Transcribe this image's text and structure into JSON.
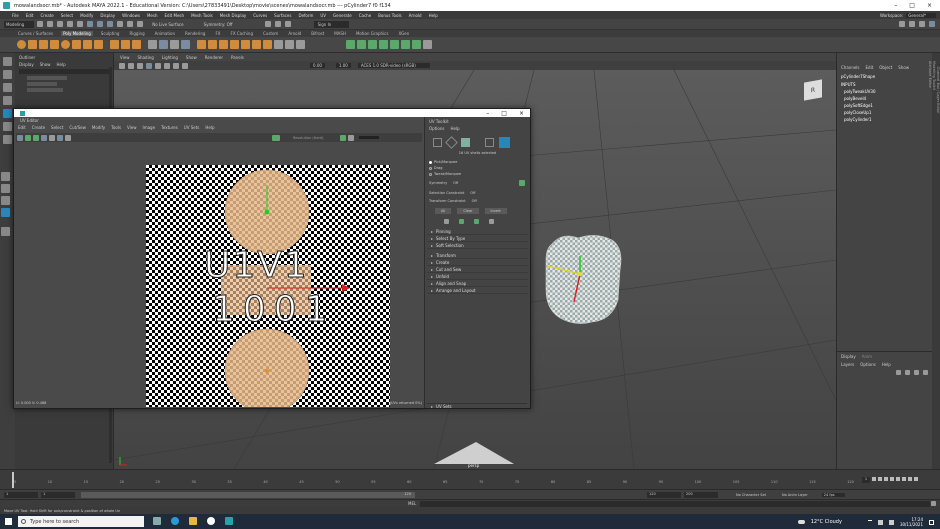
{
  "window": {
    "title": "mowalandsocr.mb* - Autodesk MAYA 2022.1 - Educational Version: C:\\Users\\27833491\\Desktop\\movie\\scenes\\mowalandsocr.mb --- pCylinder7 f0 f134"
  },
  "menubar": [
    "File",
    "Edit",
    "Create",
    "Select",
    "Modify",
    "Display",
    "Windows",
    "Mesh",
    "Edit Mesh",
    "Mesh Tools",
    "Mesh Display",
    "Curves",
    "Surfaces",
    "Deform",
    "UV",
    "Generate",
    "Cache",
    "Bonus Tools",
    "Arnold",
    "Help"
  ],
  "status": {
    "mode": "Modeling",
    "live_surface": "No Live Surface",
    "symmetry": "Symmetry: Off",
    "sign_in": "Sign In",
    "workspace_label": "Workspace:",
    "workspace_value": "General*"
  },
  "shelf_tabs": [
    "Curves / Surfaces",
    "Poly Modeling",
    "Sculpting",
    "Rigging",
    "Animation",
    "Rendering",
    "FX",
    "FX Caching",
    "Custom",
    "Arnold",
    "Bifrost",
    "MASH",
    "Motion Graphics",
    "XGen"
  ],
  "shelf_active": "Poly Modeling",
  "outliner": {
    "title": "Outliner",
    "menu": [
      "Display",
      "Show",
      "Help"
    ],
    "search_placeholder": "Search..."
  },
  "viewport": {
    "menu": [
      "View",
      "Shading",
      "Lighting",
      "Show",
      "Renderer",
      "Panels"
    ],
    "exposure": "0.00",
    "gamma": "1.00",
    "color_space": "ACES 1.0 SDR-video (sRGB)",
    "camera_label": "persp",
    "cube_label": "R"
  },
  "uv_editor": {
    "title": "UV Editor",
    "menu": [
      "Edit",
      "Create",
      "Select",
      "Cut/Sew",
      "Modify",
      "Tools",
      "View",
      "Image",
      "Textures",
      "UV Sets",
      "Help"
    ],
    "resolution_label": "Resolution (Hard)",
    "coords": "U: 0.000 V: 0.488",
    "status_right": "(UVs returned 0%)",
    "tile_text_top": "U1V1",
    "tile_text_bottom": "1001"
  },
  "uv_toolkit": {
    "title": "UV Toolkit",
    "menu": [
      "Options",
      "Help"
    ],
    "selected_info": "16 UV shells selected",
    "pick_marquee": "Pick/Marquee",
    "drag": "Drag",
    "tweak_marquee": "Tweak/Marquee",
    "symmetry_label": "Symmetry",
    "symmetry_value": "Off",
    "selection_constraint_label": "Selection Constraint",
    "selection_constraint_value": "Off",
    "transform_constraint_label": "Transform Constraint",
    "transform_constraint_value": "Off",
    "buttons": [
      "All",
      "Clear",
      "Invert"
    ],
    "sections": [
      "Pinning",
      "Select By Type",
      "Soft Selection",
      "Transform",
      "Create",
      "Cut and Sew",
      "Unfold",
      "Align and Snap",
      "Arrange and Layout"
    ],
    "uv_sets_section": "UV Sets"
  },
  "channel_box": {
    "tabs": [
      "Channels",
      "Edit",
      "Object",
      "Show"
    ],
    "object": "pCylinder7Shape",
    "inputs_label": "INPUTS",
    "inputs": [
      "polyTweakUV30",
      "polyBevel4",
      "polySoftEdge1",
      "polyCloseUp1",
      "polyCylinder1"
    ],
    "display_tabs": [
      "Display",
      "Anim"
    ],
    "layer_menu": [
      "Layers",
      "Options",
      "Help"
    ],
    "side_tabs": [
      "Channel Box / Layer Editor",
      "Modelling Toolkit",
      "Attribute Editor"
    ]
  },
  "timeline": {
    "ticks": [
      "5",
      "10",
      "15",
      "20",
      "25",
      "30",
      "35",
      "40",
      "45",
      "50",
      "55",
      "60",
      "65",
      "70",
      "75",
      "80",
      "85",
      "90",
      "95",
      "100",
      "105",
      "110",
      "115",
      "120"
    ],
    "current_frame": "1",
    "start_frame": "1",
    "range_start": "1",
    "range_end": "120",
    "anim_end": "120",
    "anim_end_total": "200",
    "character_set": "No Character Set",
    "anim_layer": "No Anim Layer",
    "fps": "24 fps"
  },
  "cmdline": {
    "lang": "MEL"
  },
  "helpline": {
    "text": "Move UV Tool: Hold Shift for axis/constraint & position of whole Uv"
  },
  "taskbar": {
    "search_placeholder": "Type here to search",
    "weather": "12°C Cloudy",
    "time": "17:24",
    "date": "30/11/2021"
  },
  "colors": {
    "accent": "#2a86b8",
    "shelf_orange": "#d08b3c",
    "uv_shell_fill": "#e8b88a",
    "manip_green": "#1fd11f",
    "manip_red": "#e21a1a"
  }
}
